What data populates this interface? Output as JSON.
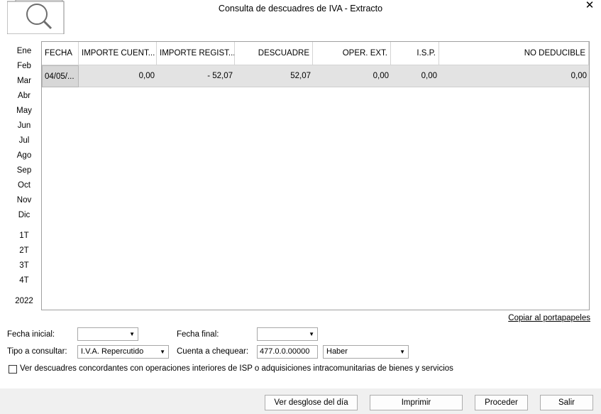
{
  "window": {
    "title": "Consulta de descuadres de IVA - Extracto",
    "close_glyph": "✕"
  },
  "header_icon": "document-magnifier-icon",
  "periods": {
    "months": [
      "Ene",
      "Feb",
      "Mar",
      "Abr",
      "May",
      "Jun",
      "Jul",
      "Ago",
      "Sep",
      "Oct",
      "Nov",
      "Dic"
    ],
    "quarters": [
      "1T",
      "2T",
      "3T",
      "4T"
    ],
    "year": "2022"
  },
  "table": {
    "columns": [
      "FECHA",
      "IMPORTE CUENT...",
      "IMPORTE REGIST...",
      "DESCUADRE",
      "OPER. EXT.",
      "I.S.P.",
      "NO DEDUCIBLE"
    ],
    "rows": [
      [
        "04/05/...",
        "0,00",
        "- 52,07",
        "52,07",
        "0,00",
        "0,00",
        "0,00"
      ]
    ]
  },
  "copy_link": "Copiar al portapapeles",
  "filters": {
    "fecha_inicial_label": "Fecha inicial:",
    "fecha_inicial_value": "",
    "fecha_final_label": "Fecha final:",
    "fecha_final_value": "",
    "tipo_label": "Tipo a consultar:",
    "tipo_value": "I.V.A. Repercutido",
    "cuenta_label": "Cuenta a chequear:",
    "cuenta_value": "477.0.0.00000",
    "lado_value": "Haber"
  },
  "checkbox": {
    "label": "Ver descuadres concordantes con operaciones interiores de ISP o adquisiciones intracomunitarias de bienes y servicios",
    "checked": false
  },
  "buttons": {
    "desglose": "Ver desglose del día",
    "imprimir": "Imprimir",
    "proceder": "Proceder",
    "salir": "Salir"
  }
}
